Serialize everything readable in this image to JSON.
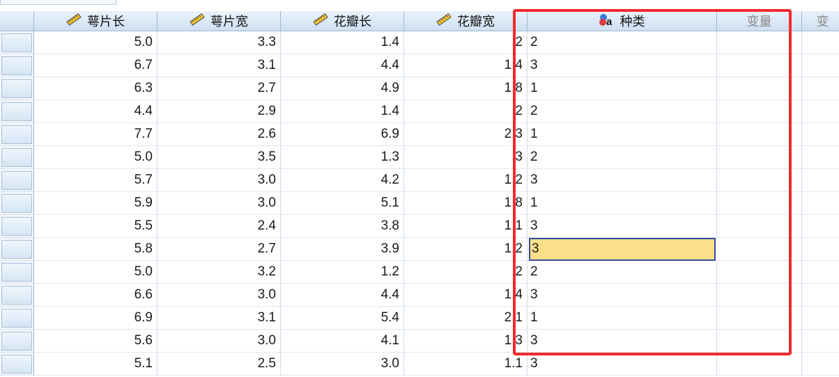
{
  "columns": [
    {
      "label": "萼片长",
      "icon": "ruler-icon"
    },
    {
      "label": "萼片宽",
      "icon": "ruler-icon"
    },
    {
      "label": "花瓣长",
      "icon": "ruler-icon"
    },
    {
      "label": "花瓣宽",
      "icon": "ruler-icon"
    },
    {
      "label": "种类",
      "icon": "nominal-variable-icon"
    },
    {
      "label": "变量",
      "icon": ""
    },
    {
      "label": "变",
      "icon": ""
    }
  ],
  "rows": [
    [
      "5.0",
      "3.3",
      "1.4",
      ".2",
      "2"
    ],
    [
      "6.7",
      "3.1",
      "4.4",
      "1.4",
      "3"
    ],
    [
      "6.3",
      "2.7",
      "4.9",
      "1.8",
      "1"
    ],
    [
      "4.4",
      "2.9",
      "1.4",
      ".2",
      "2"
    ],
    [
      "7.7",
      "2.6",
      "6.9",
      "2.3",
      "1"
    ],
    [
      "5.0",
      "3.5",
      "1.3",
      ".3",
      "2"
    ],
    [
      "5.7",
      "3.0",
      "4.2",
      "1.2",
      "3"
    ],
    [
      "5.9",
      "3.0",
      "5.1",
      "1.8",
      "1"
    ],
    [
      "5.5",
      "2.4",
      "3.8",
      "1.1",
      "3"
    ],
    [
      "5.8",
      "2.7",
      "3.9",
      "1.2",
      "3"
    ],
    [
      "5.0",
      "3.2",
      "1.2",
      ".2",
      "2"
    ],
    [
      "6.6",
      "3.0",
      "4.4",
      "1.4",
      "3"
    ],
    [
      "6.9",
      "3.1",
      "5.4",
      "2.1",
      "1"
    ],
    [
      "5.6",
      "3.0",
      "4.1",
      "1.3",
      "3"
    ],
    [
      "5.1",
      "2.5",
      "3.0",
      "1.1",
      "3"
    ]
  ],
  "active_cell": {
    "row": 9,
    "col": 4
  },
  "colors": {
    "highlight": "#ef2b2b",
    "active_fill": "#ffe08a"
  }
}
